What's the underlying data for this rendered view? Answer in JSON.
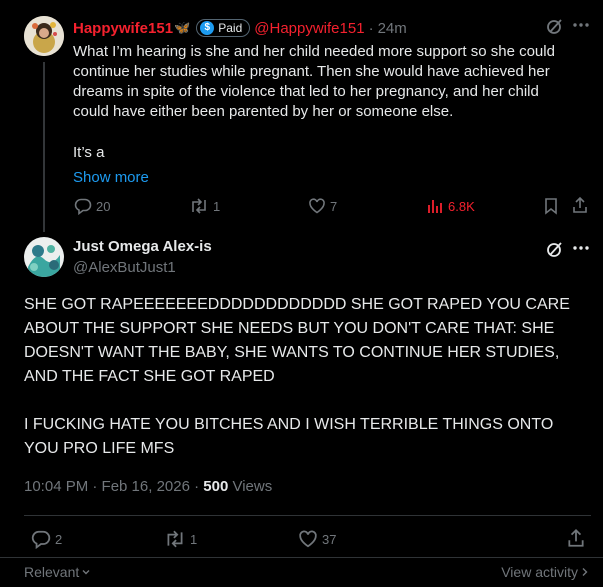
{
  "reply": {
    "display_name": "Happywife151",
    "name_emoji": "🦋",
    "badge_label": "Paid",
    "handle": "@Happywife151",
    "separator": "·",
    "time": "24m",
    "body_lines": [
      "What I’m hearing is she and her child needed more support so she could",
      "continue her studies while pregnant. Then she would have achieved her",
      "dreams in spite of the violence that led to her pregnancy, and her child",
      "could have either been parented by her or someone else."
    ],
    "body_tail": "It’s a",
    "show_more": "Show more",
    "replies": "20",
    "reposts": "1",
    "likes": "7",
    "views": "6.8K",
    "accent_color": "#f4212e"
  },
  "main": {
    "display_name": "Just Omega Alex-is",
    "handle": "@AlexButJust1",
    "body_lines": [
      "SHE GOT RAPEEEEEEEDDDDDDDDDDDD SHE GOT RAPED YOU CARE",
      "ABOUT THE SUPPORT SHE NEEDS BUT YOU DON'T CARE THAT: SHE",
      "DOESN'T WANT THE BABY, SHE WANTS TO CONTINUE HER STUDIES,",
      "AND THE FACT SHE GOT RAPED"
    ],
    "body_lines2": [
      "I FUCKING HATE YOU BITCHES AND I WISH TERRIBLE THINGS ONTO",
      "YOU PRO LIFE MFS"
    ],
    "timestamp": "10:04 PM · Feb 16, 2026 · ",
    "views_count": "500",
    "views_label": " Views",
    "replies": "2",
    "reposts": "1",
    "likes": "37"
  },
  "footer": {
    "relevant_label": "Relevant",
    "view_activity_label": "View activity"
  },
  "colors": {
    "background": "#000000",
    "text": "#e7e9ea",
    "muted": "#71767b",
    "link": "#1d9bf0",
    "divider": "#2f3336"
  }
}
